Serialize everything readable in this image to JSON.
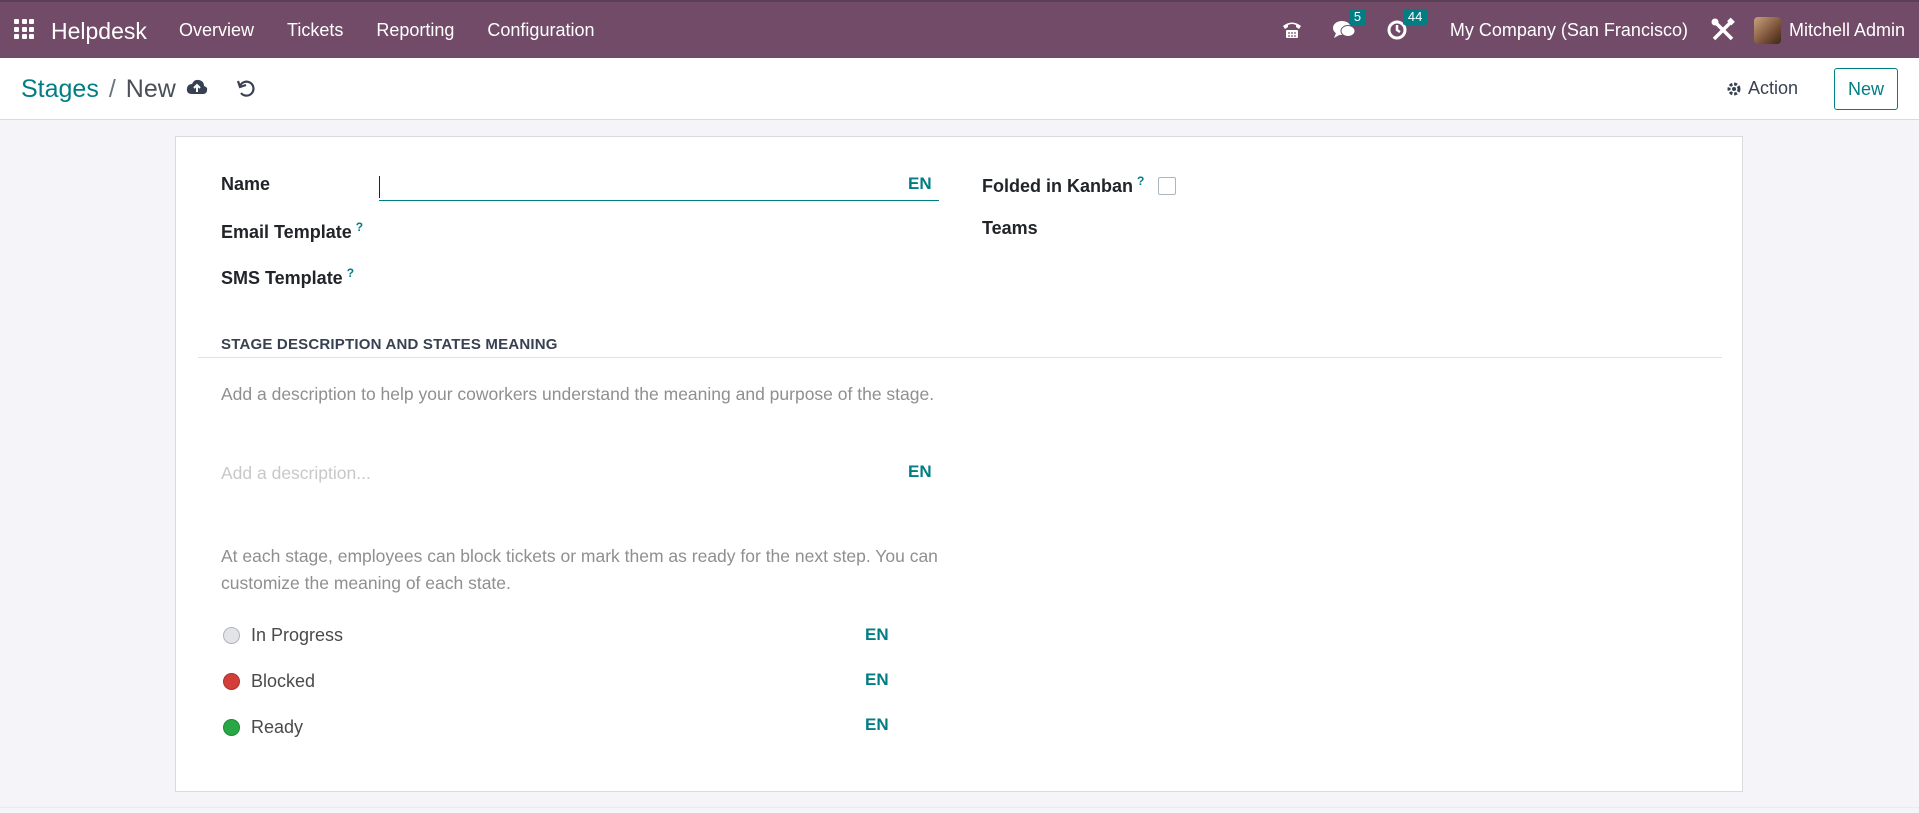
{
  "navbar": {
    "brand": "Helpdesk",
    "menu": [
      "Overview",
      "Tickets",
      "Reporting",
      "Configuration"
    ],
    "messages_count": "5",
    "activities_count": "44",
    "company": "My Company (San Francisco)",
    "user": "Mitchell Admin",
    "accent": "#714b67"
  },
  "control": {
    "breadcrumb_parent": "Stages",
    "breadcrumb_current": "New",
    "action_label": "Action",
    "new_label": "New"
  },
  "form": {
    "name_label": "Name",
    "email_template_label": "Email Template",
    "sms_template_label": "SMS Template",
    "folded_label": "Folded in Kanban",
    "teams_label": "Teams",
    "help_mark": "?",
    "lang": "EN",
    "name_value": ""
  },
  "description": {
    "section_title": "STAGE DESCRIPTION AND STATES MEANING",
    "help_text": "Add a description to help your coworkers understand the meaning and purpose of the stage.",
    "placeholder": "Add a description...",
    "states_help": "At each stage, employees can block tickets or mark them as ready for the next step. You can customize the meaning of each state.",
    "states": [
      {
        "label": "In Progress",
        "color": "#e4e4e7"
      },
      {
        "label": "Blocked",
        "color": "#d23f3a"
      },
      {
        "label": "Ready",
        "color": "#28a745"
      }
    ]
  }
}
